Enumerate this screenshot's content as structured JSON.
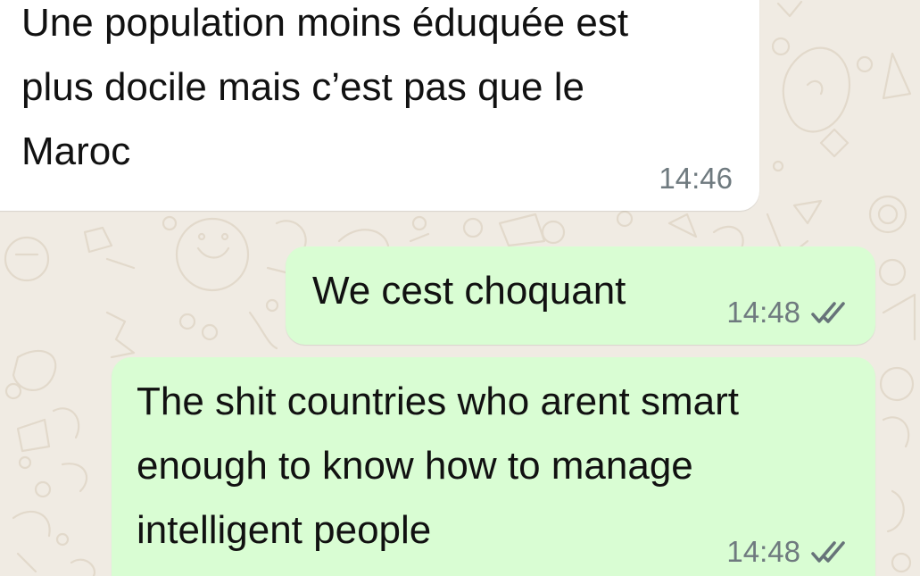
{
  "chat": {
    "messages": [
      {
        "direction": "incoming",
        "text": "Une population moins éduquée est\nplus docile mais c’est pas que le\nMaroc",
        "time": "14:46"
      },
      {
        "direction": "outgoing",
        "text": "We cest choquant",
        "time": "14:48",
        "status": "read-double-check-icon"
      },
      {
        "direction": "outgoing",
        "text": "The shit countries who arent smart\nenough to know how to manage\nintelligent people",
        "time": "14:48",
        "status": "read-double-check-icon"
      }
    ]
  },
  "colors": {
    "wallpaper": "#f0ebe3",
    "doodle": "#e2d9cb",
    "incoming_bubble": "#ffffff",
    "outgoing_bubble": "#d9fdd3",
    "timestamp": "#6f7a7f"
  }
}
